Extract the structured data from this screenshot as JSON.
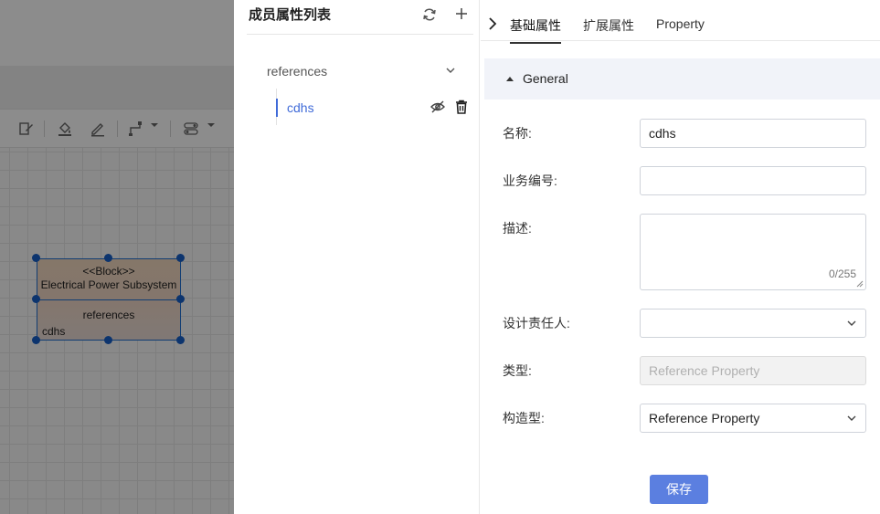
{
  "canvas": {
    "block": {
      "stereotype": "<<Block>>",
      "name": "Electrical Power Subsystem",
      "compartment": "references",
      "item": "cdhs"
    },
    "toolbar": {
      "icons": [
        "layer-style-icon",
        "fill-color-icon",
        "pen-icon",
        "connector-icon",
        "toggle-icon"
      ]
    }
  },
  "member_panel": {
    "title": "成员属性列表",
    "tree": {
      "group": "references",
      "items": [
        {
          "label": "cdhs"
        }
      ]
    }
  },
  "detail_panel": {
    "tabs": [
      {
        "label": "基础属性",
        "active": true
      },
      {
        "label": "扩展属性",
        "active": false
      },
      {
        "label": "Property",
        "active": false
      }
    ],
    "section": "General",
    "fields": {
      "name": {
        "label": "名称:",
        "value": "cdhs"
      },
      "biz_id": {
        "label": "业务编号:",
        "value": ""
      },
      "desc": {
        "label": "描述:",
        "value": "",
        "counter": "0/255"
      },
      "owner": {
        "label": "设计责任人:",
        "value": ""
      },
      "type": {
        "label": "类型:",
        "placeholder": "Reference Property"
      },
      "stereotype": {
        "label": "构造型:",
        "value": "Reference Property"
      }
    },
    "save_label": "保存"
  },
  "colors": {
    "accent": "#3f6ad8",
    "save_button": "#5b7fe0",
    "selection": "#1660c9"
  }
}
